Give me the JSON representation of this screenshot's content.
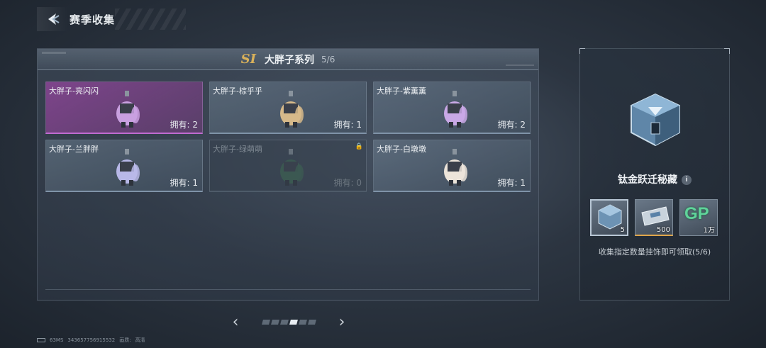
{
  "header": {
    "title": "赛季收集"
  },
  "panel": {
    "season_badge": "SI",
    "series_title": "大胖子系列",
    "series_count": "5/6"
  },
  "items": [
    {
      "name": "大胖子-亮闪闪",
      "owned": "拥有: 2",
      "color": "#c9a0e0",
      "style": "purple"
    },
    {
      "name": "大胖子-棕乎乎",
      "owned": "拥有: 1",
      "color": "#d6b98a",
      "style": "normal"
    },
    {
      "name": "大胖子-紫薰薰",
      "owned": "拥有: 2",
      "color": "#c9a8e6",
      "style": "normal"
    },
    {
      "name": "大胖子-兰胖胖",
      "owned": "拥有: 1",
      "color": "#b8b8e8",
      "style": "normal"
    },
    {
      "name": "大胖子-绿萌萌",
      "owned": "拥有: 0",
      "color": "#3e6a52",
      "style": "locked"
    },
    {
      "name": "大胖子-白墩墩",
      "owned": "拥有: 1",
      "color": "#ece4da",
      "style": "normal"
    }
  ],
  "pagination": {
    "total_pages": 6,
    "current_page": 4
  },
  "footer": {
    "ping": "63MS",
    "uid": "343657756915532",
    "quality_label": "画质:",
    "quality_value": "高清"
  },
  "reward": {
    "title": "钛金跃迁秘藏",
    "info_icon": "i",
    "items": [
      {
        "icon": "chest-icon",
        "qty": "5"
      },
      {
        "icon": "ticket-icon",
        "qty": "500"
      },
      {
        "icon": "gp-icon",
        "qty": "1万",
        "label": "GP"
      }
    ],
    "description": "收集指定数量挂饰即可领取(5/6)"
  }
}
